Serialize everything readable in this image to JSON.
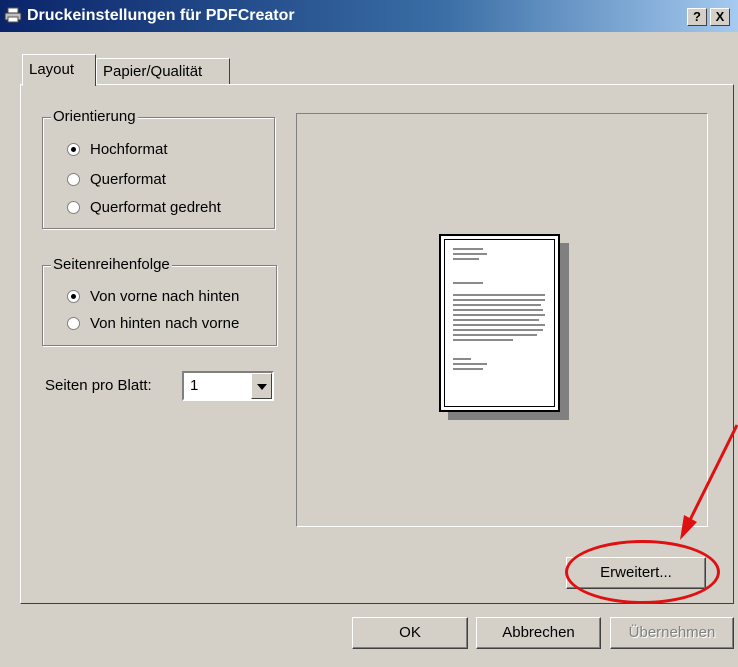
{
  "window": {
    "title": "Druckeinstellungen für PDFCreator",
    "help_label": "?",
    "close_label": "X"
  },
  "tabs": [
    {
      "label": "Layout",
      "active": true
    },
    {
      "label": "Papier/Qualität",
      "active": false
    }
  ],
  "orientation": {
    "title": "Orientierung",
    "options": [
      {
        "label": "Hochformat",
        "checked": true
      },
      {
        "label": "Querformat",
        "checked": false
      },
      {
        "label": "Querformat gedreht",
        "checked": false
      }
    ]
  },
  "page_order": {
    "title": "Seitenreihenfolge",
    "options": [
      {
        "label": "Von vorne nach hinten",
        "checked": true
      },
      {
        "label": "Von hinten nach vorne",
        "checked": false
      }
    ]
  },
  "pages_per_sheet": {
    "label": "Seiten pro Blatt:",
    "value": "1"
  },
  "buttons": {
    "advanced": "Erweitert...",
    "ok": "OK",
    "cancel": "Abbrechen",
    "apply": "Übernehmen"
  },
  "icons": {
    "app": "printer-icon",
    "dropdown": "chevron-down-icon"
  },
  "colors": {
    "title_gradient_start": "#0a246a",
    "title_gradient_end": "#a6caf0",
    "dialog_face": "#d4d0c8",
    "annotation": "#e01010"
  }
}
